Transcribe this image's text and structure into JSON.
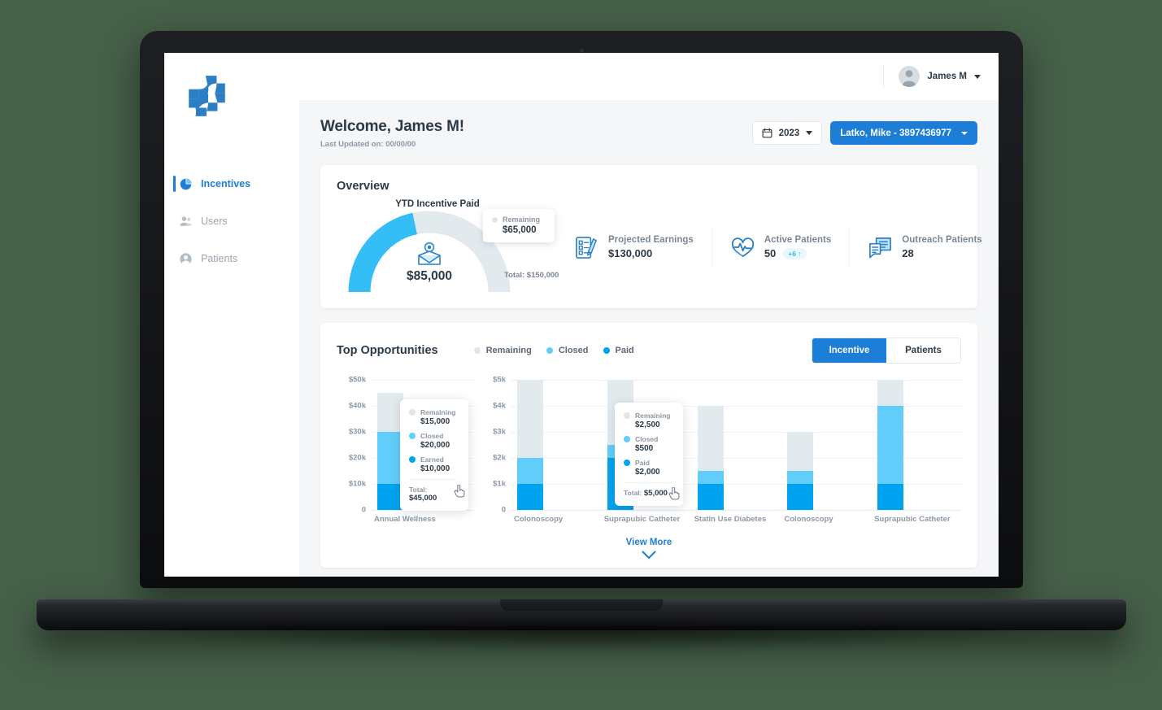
{
  "sidebar": {
    "logo_name": "pinwheel-cross-logo",
    "items": [
      {
        "label": "Incentives",
        "icon": "pie-chart-icon",
        "active": true
      },
      {
        "label": "Users",
        "icon": "users-icon",
        "active": false
      },
      {
        "label": "Patients",
        "icon": "person-circle-icon",
        "active": false
      }
    ]
  },
  "topbar": {
    "user_name": "James M",
    "avatar_icon": "avatar-icon",
    "caret_icon": "chevron-down-icon"
  },
  "header": {
    "welcome_title": "Welcome, James M!",
    "last_updated": "Last Updated on: 00/00/00",
    "year_value": "2023",
    "calendar_icon": "calendar-icon",
    "patient_value": "Latko, Mike - 3897436977"
  },
  "overview": {
    "title": "Overview",
    "gauge": {
      "label": "YTD Incentive Paid",
      "value": "$85,000",
      "total": "Total: $150,000",
      "icon": "incentive-envelope-icon",
      "paid_amount": 85000,
      "total_amount": 150000,
      "tooltip": {
        "key": "Remaining",
        "value": "$65,000"
      }
    },
    "stats": [
      {
        "label": "Projected Earnings",
        "value": "$130,000",
        "icon": "document-pen-icon",
        "delta": ""
      },
      {
        "label": "Active Patients",
        "value": "50",
        "icon": "heart-pulse-icon",
        "delta": "+6 ↑"
      },
      {
        "label": "Outreach Patients",
        "value": "28",
        "icon": "chat-document-icon",
        "delta": ""
      }
    ]
  },
  "opportunities": {
    "title": "Top Opportunities",
    "legend": [
      {
        "label": "Remaining",
        "color": "#dfe5ea"
      },
      {
        "label": "Closed",
        "color": "#62cdfa"
      },
      {
        "label": "Paid",
        "color": "#00a3f0"
      }
    ],
    "toggles": [
      {
        "label": "Incentive",
        "active": true
      },
      {
        "label": "Patients",
        "active": false
      }
    ],
    "view_more": "View More",
    "view_more_icon": "chevron-down-icon"
  },
  "chart_data": [
    {
      "type": "bar",
      "id": "chart-left",
      "title": "",
      "stacked": true,
      "categories": [
        "Annual Wellness"
      ],
      "series": [
        {
          "name": "Paid",
          "color": "#00a3f0",
          "values": [
            10000
          ]
        },
        {
          "name": "Closed",
          "color": "#62cdfa",
          "values": [
            20000
          ]
        },
        {
          "name": "Remaining",
          "color": "#e3eaee",
          "values": [
            15000
          ]
        }
      ],
      "yticks": [
        "0",
        "$10k",
        "$20k",
        "$30k",
        "$40k",
        "$50k"
      ],
      "ytickvalues": [
        0,
        10000,
        20000,
        30000,
        40000,
        50000
      ],
      "ylim": [
        0,
        50000
      ],
      "grid": true,
      "legend_position": "top",
      "tooltip": {
        "rows": [
          {
            "key": "Remaining",
            "value": "$15,000",
            "color": "#dfe5ea"
          },
          {
            "key": "Closed",
            "value": "$20,000",
            "color": "#62cdfa"
          },
          {
            "key": "Earned",
            "value": "$10,000",
            "color": "#00a3f0"
          }
        ],
        "total_label": "Total:",
        "total_value": "$45,000"
      }
    },
    {
      "type": "bar",
      "id": "chart-right",
      "title": "",
      "stacked": true,
      "categories": [
        "Colonoscopy",
        "Suprapubic Catheter",
        "Statin Use Diabetes",
        "Colonoscopy",
        "Suprapubic Catheter"
      ],
      "series": [
        {
          "name": "Paid",
          "color": "#00a3f0",
          "values": [
            1000,
            2000,
            1000,
            1000,
            1000
          ]
        },
        {
          "name": "Closed",
          "color": "#62cdfa",
          "values": [
            1000,
            500,
            500,
            500,
            3000
          ]
        },
        {
          "name": "Remaining",
          "color": "#e3eaee",
          "values": [
            3000,
            2500,
            2500,
            1500,
            1000
          ]
        }
      ],
      "yticks": [
        "0",
        "$1k",
        "$2k",
        "$3k",
        "$4k",
        "$5k"
      ],
      "ytickvalues": [
        0,
        1000,
        2000,
        3000,
        4000,
        5000
      ],
      "ylim": [
        0,
        5000
      ],
      "grid": true,
      "legend_position": "top",
      "tooltip": {
        "rows": [
          {
            "key": "Remaining",
            "value": "$2,500",
            "color": "#dfe5ea"
          },
          {
            "key": "Closed",
            "value": "$500",
            "color": "#62cdfa"
          },
          {
            "key": "Paid",
            "value": "$2,000",
            "color": "#00a3f0"
          }
        ],
        "total_label": "Total:",
        "total_value": "$5,000"
      }
    }
  ],
  "colors": {
    "brand_blue": "#1c7ed6",
    "paid": "#00a3f0",
    "closed": "#62cdfa",
    "remaining": "#e3eaee",
    "text_dark": "#2c3a47",
    "text_muted": "#8d98a4",
    "desktop_background": "#466049"
  }
}
